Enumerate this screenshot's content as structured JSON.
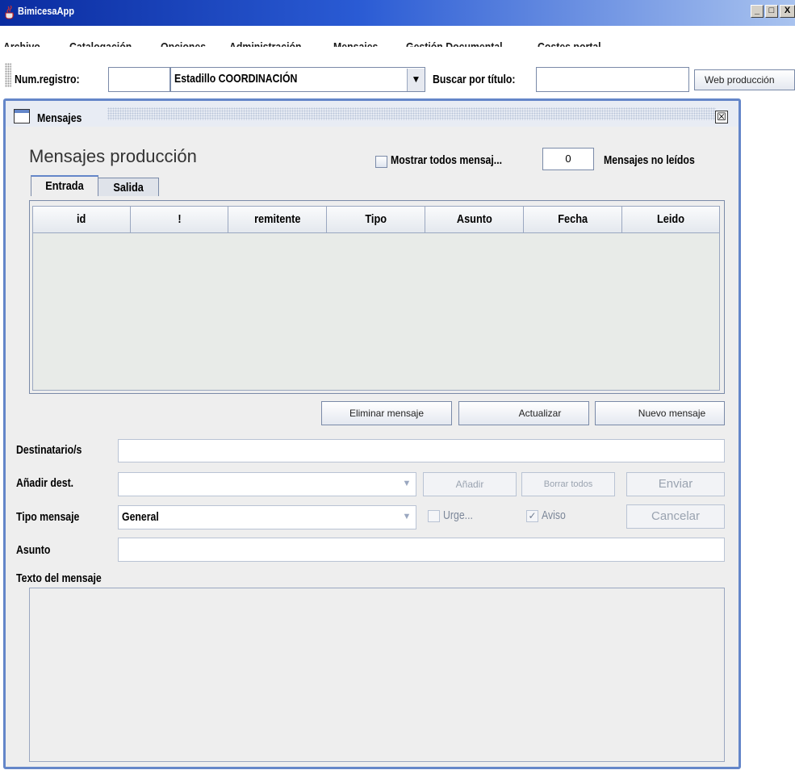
{
  "window": {
    "title": "BimicesaApp",
    "controls": [
      "_",
      "□",
      "X"
    ]
  },
  "menu": [
    "Archivo",
    "Catalogación",
    "Opciones",
    "Administración",
    "Mensajes",
    "Gestión Documental",
    "Costes portal"
  ],
  "toolbar": {
    "num_registro_label": "Num.registro:",
    "num_registro_value": "",
    "estadillo_selected": "Estadillo COORDINACIÓN",
    "buscar_label": "Buscar por título:",
    "buscar_value": "",
    "web_button": "Web producción"
  },
  "frame": {
    "title": "Mensajes",
    "close": "☒"
  },
  "messages": {
    "heading": "Mensajes producción",
    "show_all_label": "Mostrar todos mensaj...",
    "show_all_checked": false,
    "unread_count": "0",
    "unread_label": "Mensajes no leídos",
    "tabs": [
      "Entrada",
      "Salida"
    ],
    "columns": [
      "id",
      "!",
      "remitente",
      "Tipo",
      "Asunto",
      "Fecha",
      "Leido"
    ],
    "rows": [],
    "buttons": {
      "delete": "Eliminar mensaje",
      "refresh": "Actualizar",
      "new": "Nuevo mensaje"
    }
  },
  "form": {
    "destinatarios_label": "Destinatario/s",
    "destinatarios_value": "",
    "add_dest_label": "Añadir dest.",
    "add_dest_value": "",
    "add_button": "Añadir",
    "clear_button": "Borrar todos",
    "send_button": "Enviar",
    "tipo_label": "Tipo mensaje",
    "tipo_value": "General",
    "urge_label": "Urge...",
    "urge_checked": false,
    "aviso_label": "Aviso",
    "aviso_checked": true,
    "cancel_button": "Cancelar",
    "asunto_label": "Asunto",
    "asunto_value": "",
    "texto_label": "Texto del mensaje",
    "texto_value": ""
  },
  "colors": {
    "titlebar_start": "#0a2ca0",
    "frame_border": "#6486c9",
    "panel_bg": "#eeeeee"
  }
}
